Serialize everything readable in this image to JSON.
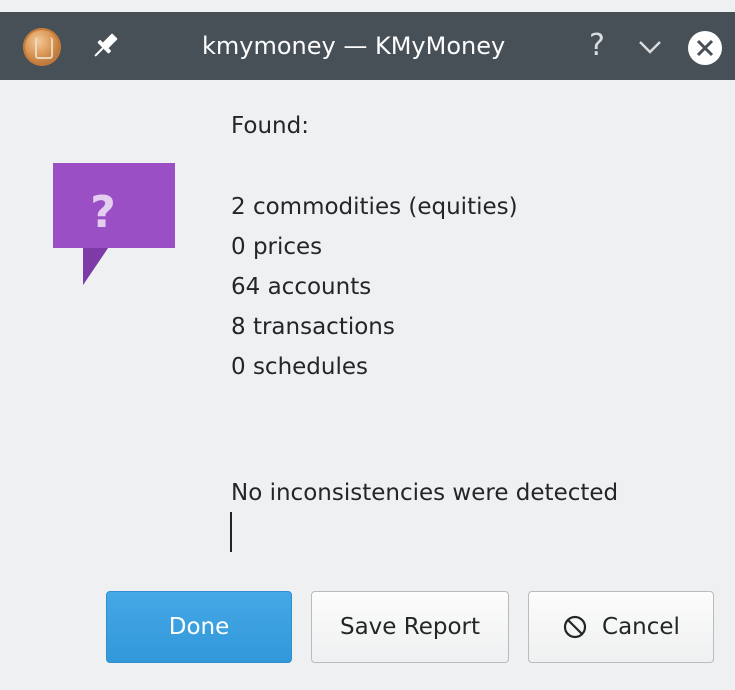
{
  "window": {
    "title": "kmymoney — KMyMoney",
    "help_glyph": "?",
    "icons": [
      "kmymoney-app-icon",
      "pin-icon",
      "help-icon",
      "minimize-chevron-icon",
      "close-icon"
    ]
  },
  "dialog": {
    "icon": "question-icon",
    "icon_glyph": "?",
    "found_label": "Found:",
    "stats": [
      "2 commodities (equities)",
      "0 prices",
      "64 accounts",
      "8 transactions",
      "0 schedules"
    ],
    "result_text": "No inconsistencies were detected"
  },
  "buttons": {
    "done": "Done",
    "save_report": "Save Report",
    "cancel": "Cancel"
  },
  "colors": {
    "titlebar": "#475057",
    "question_icon": "#9b4fc5",
    "done_button": "#3daee9",
    "background": "#eff0f1"
  }
}
